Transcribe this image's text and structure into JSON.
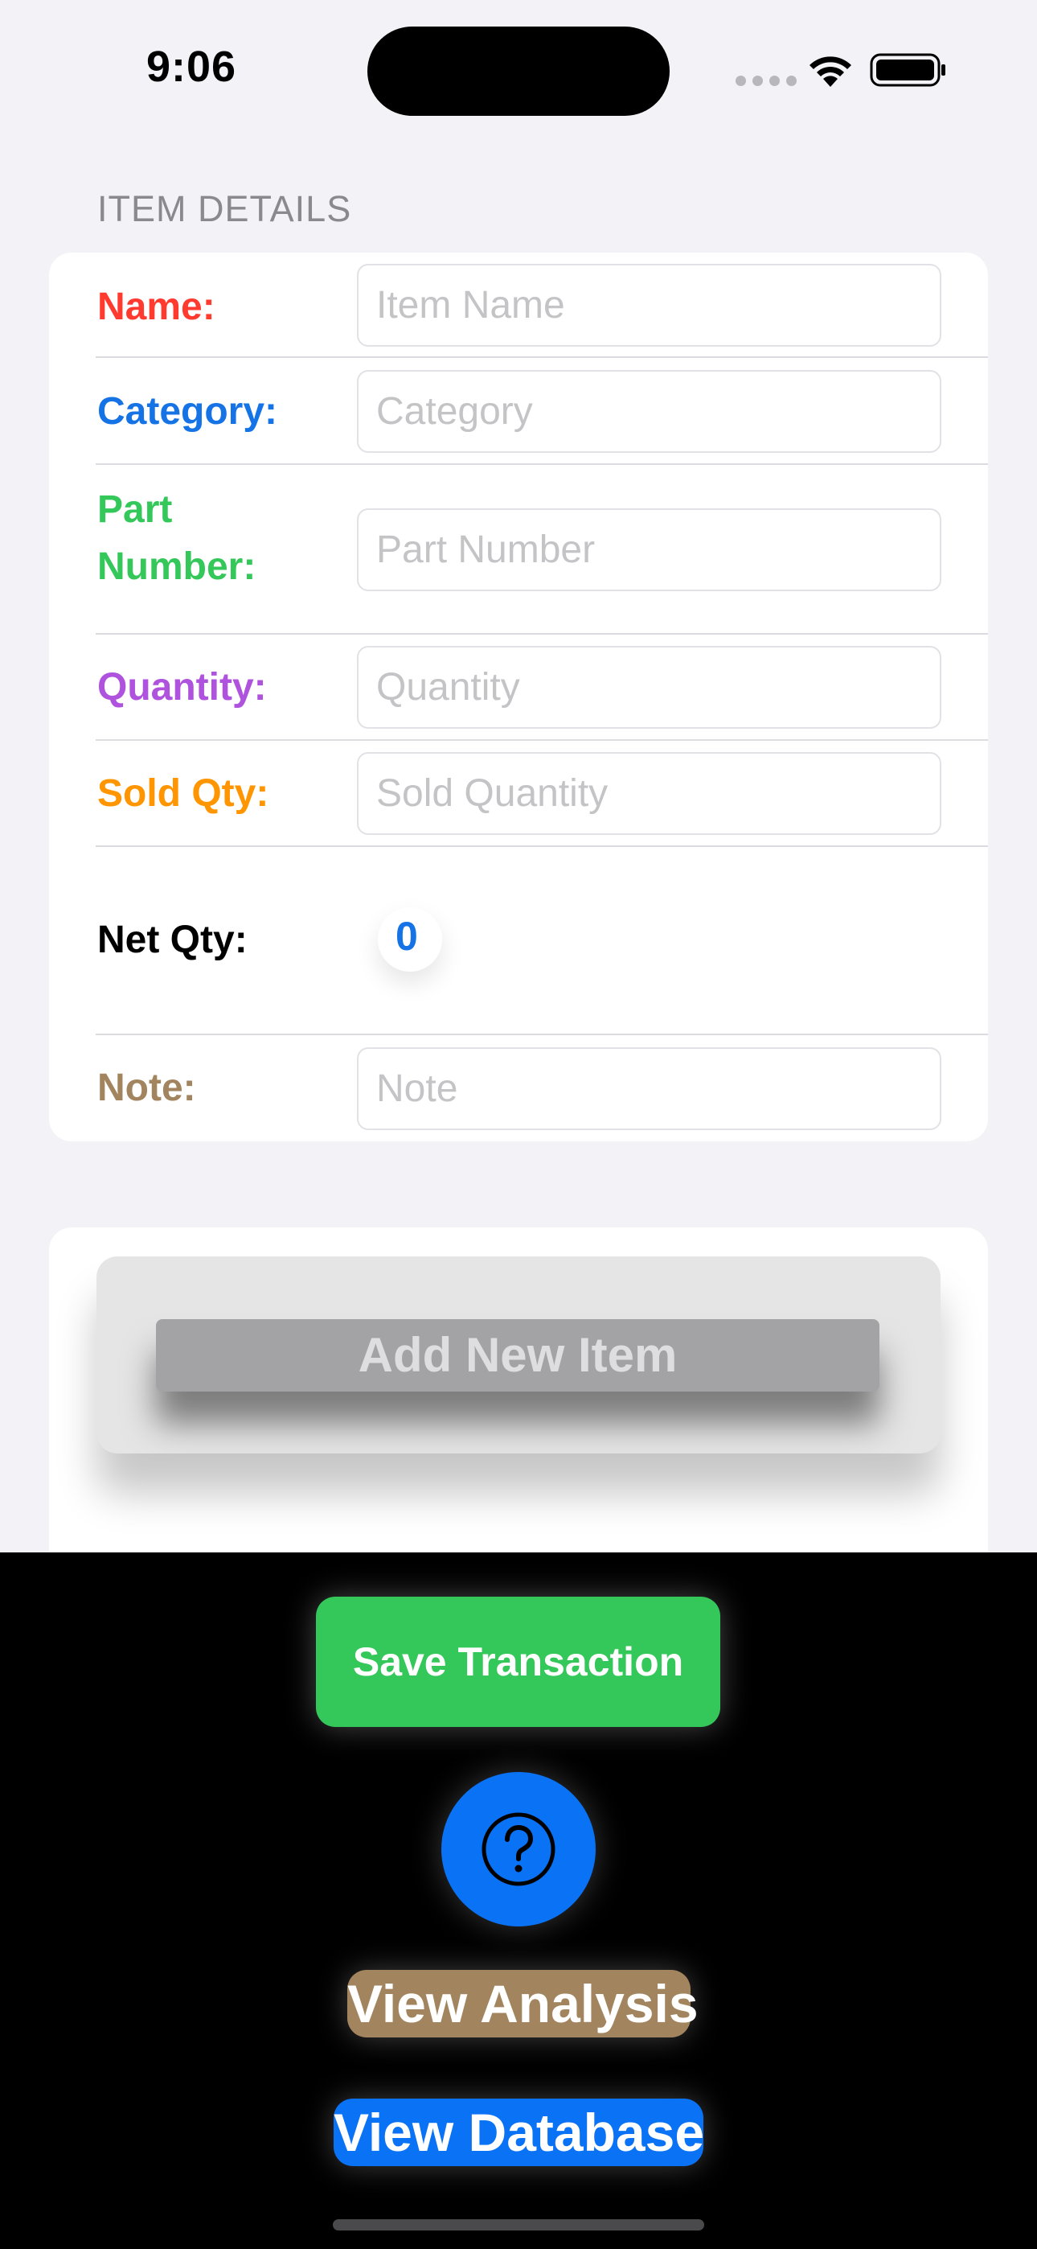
{
  "status_bar": {
    "time": "9:06",
    "icons": [
      "cellular-signal-icon",
      "wifi-icon",
      "battery-icon"
    ]
  },
  "form": {
    "section_title": "ITEM DETAILS",
    "rows": [
      {
        "label": "Name:",
        "placeholder": "Item Name",
        "value": "",
        "color": "#ff3b30"
      },
      {
        "label": "Category:",
        "placeholder": "Category",
        "value": "",
        "color": "#1573e6"
      },
      {
        "label": "Part Number:",
        "placeholder": "Part Number",
        "value": "",
        "color": "#34c759"
      },
      {
        "label": "Quantity:",
        "placeholder": "Quantity",
        "value": "",
        "color": "#af52de"
      },
      {
        "label": "Sold Qty:",
        "placeholder": "Sold Quantity",
        "value": "",
        "color": "#ff9500"
      },
      {
        "label": "Note:",
        "placeholder": "Note",
        "value": "",
        "color": "#a2845e"
      }
    ],
    "net_qty": {
      "label": "Net Qty:",
      "value": "0",
      "color": "#1573e6"
    }
  },
  "actions": {
    "add_item": {
      "label": "Add New Item",
      "enabled": false
    },
    "save_transaction": {
      "label": "Save Transaction",
      "color": "#34c759"
    },
    "help": {
      "icon": "question-mark-icon",
      "color": "#0a72f5"
    },
    "view_analysis": {
      "label": "View Analysis",
      "color": "#a2845e"
    },
    "view_database": {
      "label": "View Database",
      "color": "#0a72f5"
    }
  }
}
